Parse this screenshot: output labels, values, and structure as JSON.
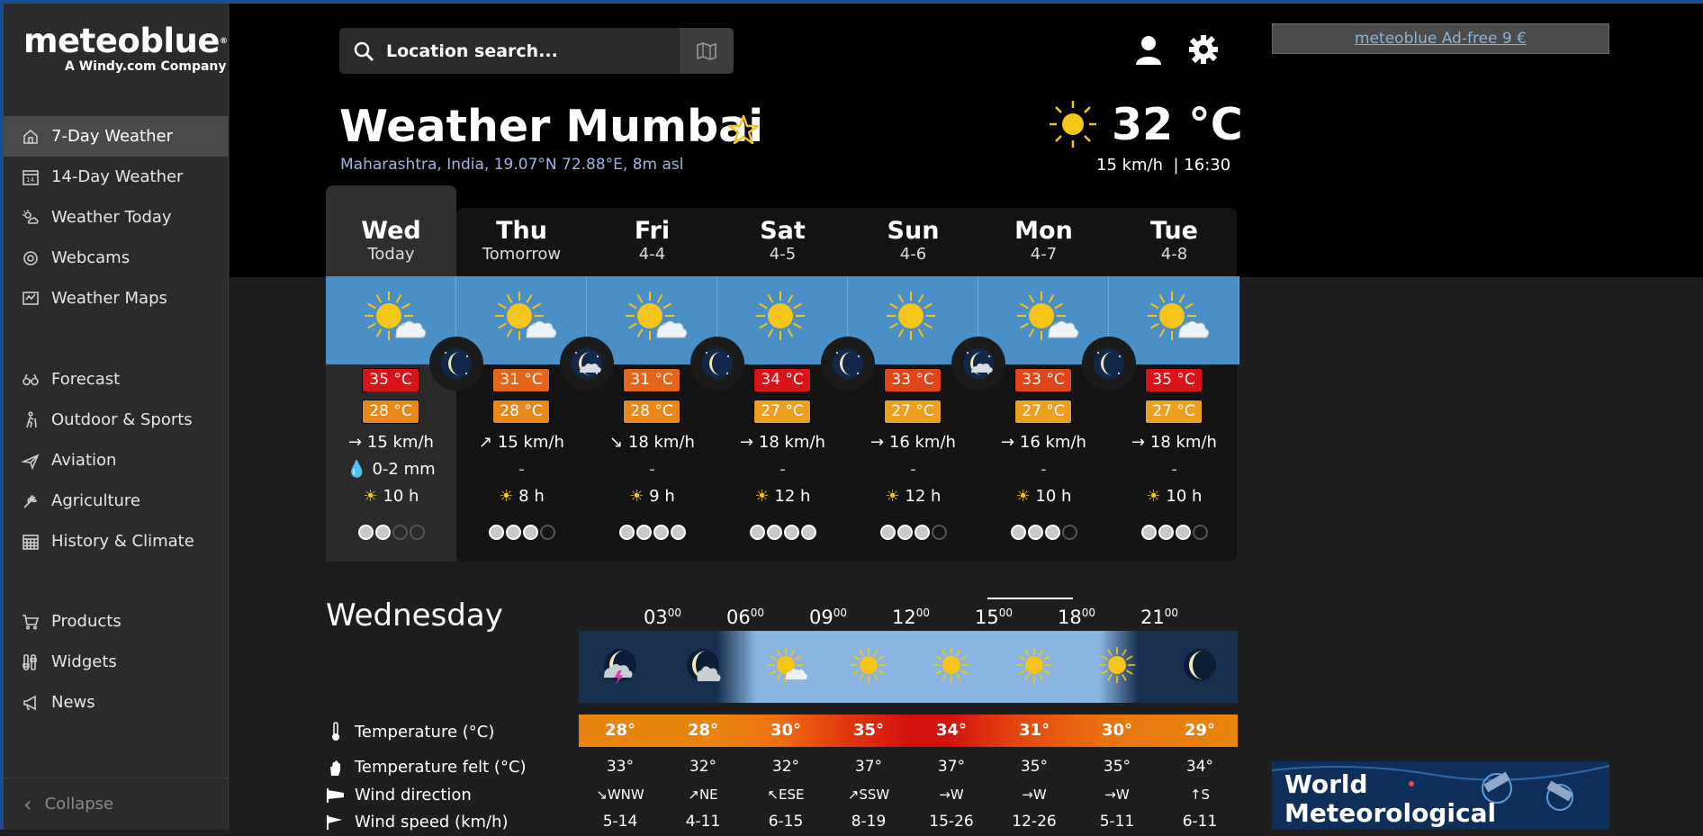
{
  "sidebar": {
    "logo": "meteoblue",
    "logo_mark": "®",
    "logo_sub": "A Windy.com Company",
    "items": [
      {
        "label": "7-Day Weather",
        "icon": "home-icon",
        "active": true
      },
      {
        "label": "14-Day Weather",
        "icon": "calendar-14-icon"
      },
      {
        "label": "Weather Today",
        "icon": "sun-cloud-icon"
      },
      {
        "label": "Webcams",
        "icon": "webcam-icon"
      },
      {
        "label": "Weather Maps",
        "icon": "map-icon"
      },
      {
        "label": "Forecast",
        "icon": "binoculars-icon"
      },
      {
        "label": "Outdoor & Sports",
        "icon": "hiker-icon"
      },
      {
        "label": "Aviation",
        "icon": "plane-icon"
      },
      {
        "label": "Agriculture",
        "icon": "agriculture-icon"
      },
      {
        "label": "History & Climate",
        "icon": "calendar-grid-icon"
      },
      {
        "label": "Products",
        "icon": "cart-icon"
      },
      {
        "label": "Widgets",
        "icon": "widgets-icon"
      },
      {
        "label": "News",
        "icon": "megaphone-icon"
      }
    ],
    "collapse": "Collapse"
  },
  "search": {
    "placeholder": "Location search..."
  },
  "ad": {
    "label": "meteoblue Ad-free 9 €"
  },
  "location": {
    "title": "Weather Mumbai",
    "subtitle": "Maharashtra, India, 19.07°N 72.88°E, 8m asl"
  },
  "current": {
    "temp": "32 °C",
    "wind": "15 km/h",
    "time": "16:30"
  },
  "days": [
    {
      "name": "Wed",
      "date": "Today",
      "tmax": "35 °C",
      "tmin": "28 °C",
      "tmax_color": "#d8141a",
      "tmin_color": "#e8881a",
      "wind": "15 km/h",
      "wind_dir": "→",
      "precip": "0-2 mm",
      "sun": "10 h",
      "predict": 2
    },
    {
      "name": "Thu",
      "date": "Tomorrow",
      "tmax": "31 °C",
      "tmin": "28 °C",
      "tmax_color": "#e5661a",
      "tmin_color": "#e8881a",
      "wind": "15 km/h",
      "wind_dir": "↗",
      "precip": "-",
      "sun": "8 h",
      "predict": 3
    },
    {
      "name": "Fri",
      "date": "4-4",
      "tmax": "31 °C",
      "tmin": "28 °C",
      "tmax_color": "#e5661a",
      "tmin_color": "#e8881a",
      "wind": "18 km/h",
      "wind_dir": "↘",
      "precip": "-",
      "sun": "9 h",
      "predict": 4
    },
    {
      "name": "Sat",
      "date": "4-5",
      "tmax": "34 °C",
      "tmin": "27 °C",
      "tmax_color": "#d8141a",
      "tmin_color": "#eca01d",
      "wind": "18 km/h",
      "wind_dir": "→",
      "precip": "-",
      "sun": "12 h",
      "predict": 4
    },
    {
      "name": "Sun",
      "date": "4-6",
      "tmax": "33 °C",
      "tmin": "27 °C",
      "tmax_color": "#e0461a",
      "tmin_color": "#eca01d",
      "wind": "16 km/h",
      "wind_dir": "→",
      "precip": "-",
      "sun": "12 h",
      "predict": 3
    },
    {
      "name": "Mon",
      "date": "4-7",
      "tmax": "33 °C",
      "tmin": "27 °C",
      "tmax_color": "#e0461a",
      "tmin_color": "#eca01d",
      "wind": "16 km/h",
      "wind_dir": "→",
      "precip": "-",
      "sun": "10 h",
      "predict": 3
    },
    {
      "name": "Tue",
      "date": "4-8",
      "tmax": "35 °C",
      "tmin": "27 °C",
      "tmax_color": "#d8141a",
      "tmin_color": "#eca01d",
      "wind": "18 km/h",
      "wind_dir": "→",
      "precip": "-",
      "sun": "10 h",
      "predict": 3
    }
  ],
  "hourly": {
    "title": "Wednesday",
    "hours": [
      "03",
      "06",
      "09",
      "12",
      "15",
      "18",
      "21"
    ],
    "hours_sup": "00",
    "temperature": {
      "label": "Temperature (°C)",
      "values": [
        "28°",
        "28°",
        "30°",
        "35°",
        "34°",
        "31°",
        "30°",
        "29°"
      ]
    },
    "felt": {
      "label": "Temperature felt (°C)",
      "values": [
        "33°",
        "32°",
        "32°",
        "37°",
        "37°",
        "35°",
        "35°",
        "34°"
      ]
    },
    "wind_dir": {
      "label": "Wind direction",
      "values": [
        "WNW",
        "NE",
        "ESE",
        "SSW",
        "W",
        "W",
        "W",
        "S"
      ],
      "arrows": [
        "↘",
        "↗",
        "↖",
        "↗",
        "→",
        "→",
        "→",
        "↑"
      ]
    },
    "wind_speed": {
      "label": "Wind speed (km/h)",
      "values": [
        "5-14",
        "4-11",
        "6-15",
        "8-19",
        "15-26",
        "12-26",
        "5-11",
        "6-11"
      ]
    }
  },
  "wmo_banner": {
    "line1": "World",
    "line2": "Meteorological"
  }
}
